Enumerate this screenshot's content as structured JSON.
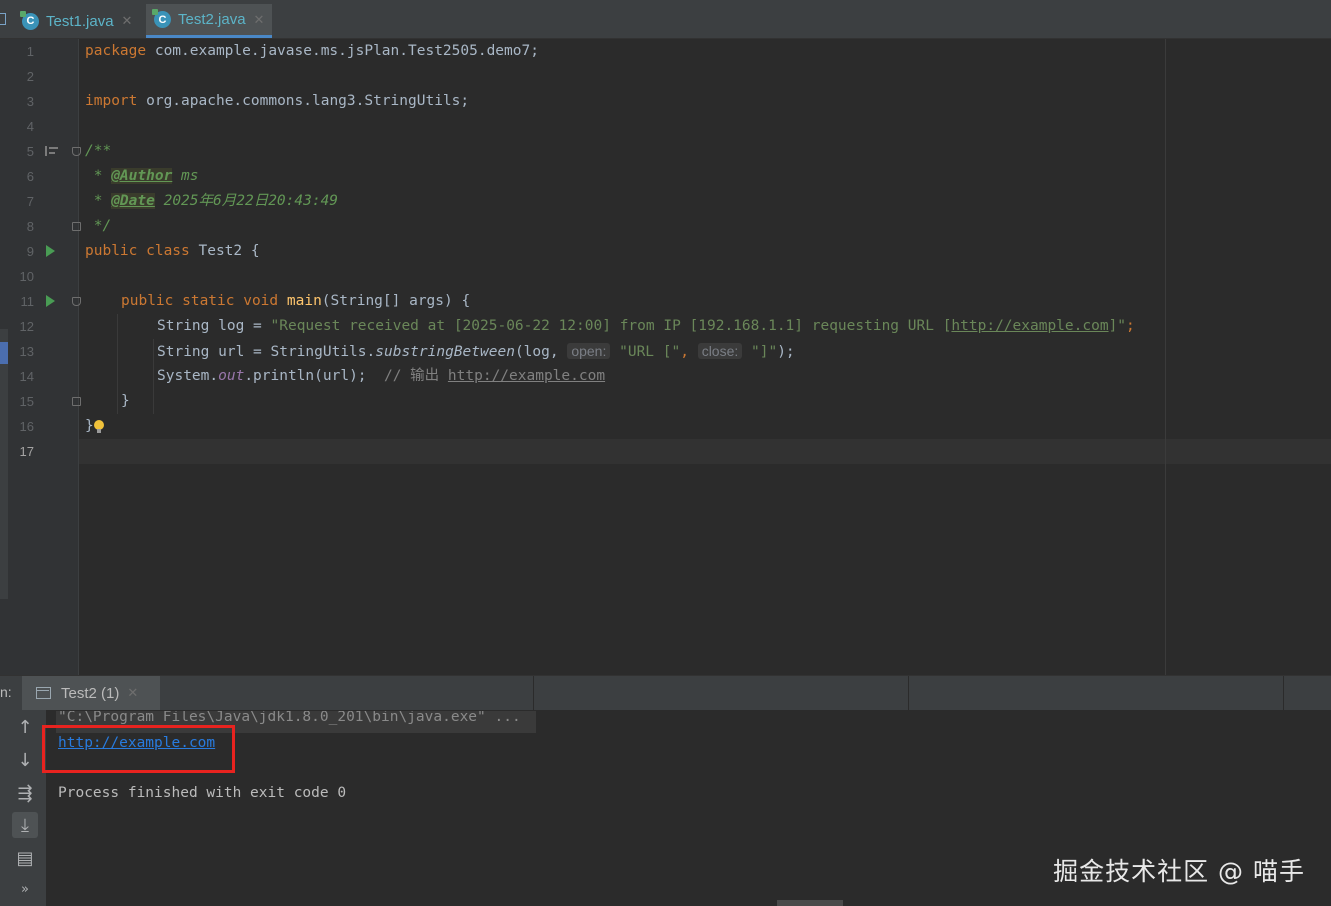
{
  "tabs": [
    {
      "label": "Test1.java",
      "icon": "java-class-icon",
      "active": false
    },
    {
      "label": "Test2.java",
      "icon": "java-class-icon",
      "active": true
    }
  ],
  "line_numbers": [
    "1",
    "2",
    "3",
    "4",
    "5",
    "6",
    "7",
    "8",
    "9",
    "10",
    "11",
    "12",
    "13",
    "14",
    "15",
    "16",
    "17"
  ],
  "code": {
    "l1_kw": "package",
    "l1_rest": " com.example.javase.ms.jsPlan.Test2505.demo7;",
    "l3_kw": "import",
    "l3_rest": " org.apache.commons.lang3.StringUtils;",
    "l5": "/**",
    "l6_star": " * ",
    "l6_tag": "@Author",
    "l6_val": " ms",
    "l7_star": " * ",
    "l7_tag": "@Date",
    "l7_val": " 2025年6月22日20:43:49",
    "l8": " */",
    "l9_kw": "public class",
    "l9_rest": " Test2 {",
    "l11_kw": "public static void",
    "l11_fn": "main",
    "l11_rest": "(String[] args) {",
    "l12_a": "String log = ",
    "l12_str": "\"Request received at [2025-06-22 12:00] from IP [192.168.1.1] requesting URL [",
    "l12_url": "http://example.com",
    "l12_str2": "]\"",
    "l12_end": ";",
    "l13_a": "String url = StringUtils.",
    "l13_fn": "substringBetween",
    "l13_b": "(log, ",
    "l13_hint1": "open:",
    "l13_s1": " \"URL [\"",
    "l13_c": ", ",
    "l13_hint2": "close:",
    "l13_s2": " \"]\"",
    "l13_end": ");",
    "l14_a": "System.",
    "l14_out": "out",
    "l14_b": ".println(url);",
    "l14_cmt": "  // 输出 ",
    "l14_url": "http://example.com",
    "l15": "}",
    "l16": "}"
  },
  "run_panel": {
    "prefix": "n:",
    "tab_label": "Test2 (1)",
    "command": "\"C:\\Program Files\\Java\\jdk1.8.0_201\\bin\\java.exe\" ...",
    "output_link": "http://example.com",
    "exit_message": "Process finished with exit code 0"
  },
  "toolbar_icons": [
    "up-arrow-icon",
    "down-arrow-icon",
    "soft-wrap-icon",
    "scroll-to-end-icon",
    "print-icon",
    "more-icon"
  ],
  "watermark": "掘金技术社区 @ 喵手",
  "colors": {
    "editor_bg": "#2b2b2b",
    "keyword": "#cc7832",
    "string": "#6a8759",
    "function": "#ffc66d",
    "doc_comment": "#629755",
    "link": "#287bde",
    "highlight_box": "#e8231f"
  }
}
